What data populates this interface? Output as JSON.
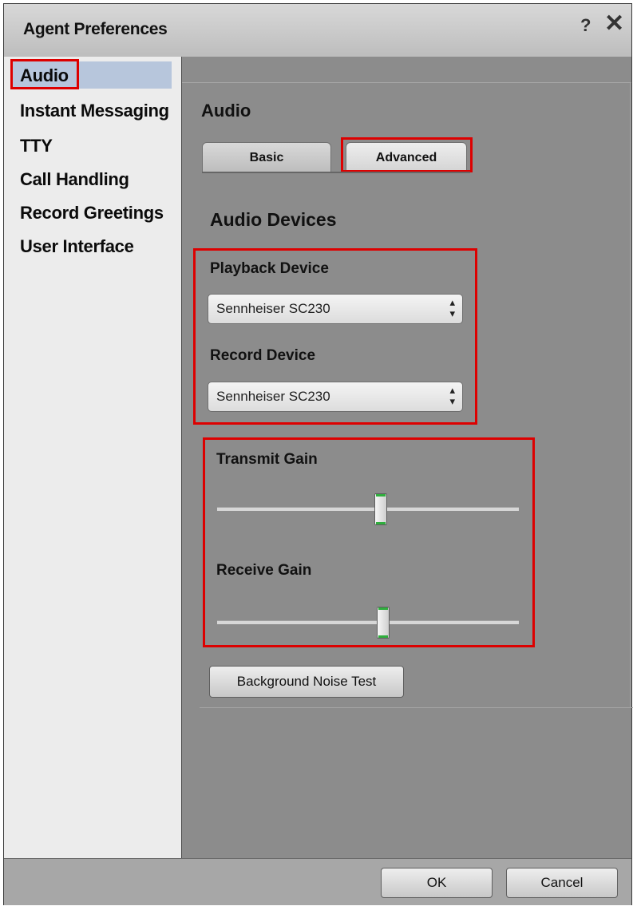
{
  "window": {
    "title": "Agent Preferences",
    "help_glyph": "?",
    "close_glyph": "✕"
  },
  "sidebar": {
    "items": [
      {
        "label": "Audio",
        "selected": true
      },
      {
        "label": "Instant Messaging"
      },
      {
        "label": "TTY"
      },
      {
        "label": "Call Handling"
      },
      {
        "label": "Record Greetings"
      },
      {
        "label": "User Interface"
      }
    ]
  },
  "main": {
    "section_title": "Audio",
    "tabs": [
      {
        "label": "Basic",
        "active": false
      },
      {
        "label": "Advanced",
        "active": true
      }
    ],
    "group_title": "Audio Devices",
    "playback": {
      "label": "Playback Device",
      "value": "Sennheiser SC230"
    },
    "record": {
      "label": "Record Device",
      "value": "Sennheiser SC230"
    },
    "transmit_gain": {
      "label": "Transmit Gain",
      "level": 0.55
    },
    "receive_gain": {
      "label": "Receive Gain",
      "level": 0.56
    },
    "noise_test_label": "Background Noise Test"
  },
  "footer": {
    "ok_label": "OK",
    "cancel_label": "Cancel"
  },
  "icons": {
    "help": "help-icon",
    "close": "close-icon",
    "dropdown": "updown-arrows-icon"
  },
  "colors": {
    "highlight": "#dd0000",
    "selection": "#b7c6dc",
    "slider_cap": "#2fae3d"
  }
}
